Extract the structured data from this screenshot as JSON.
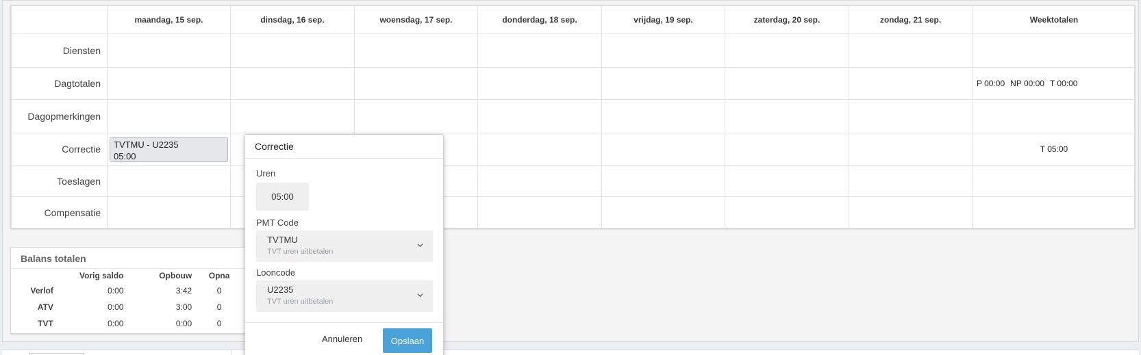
{
  "schedule": {
    "days": [
      "maandag, 15 sep.",
      "dinsdag, 16 sep.",
      "woensdag, 17 sep.",
      "donderdag, 18 sep.",
      "vrijdag, 19 sep.",
      "zaterdag, 20 sep.",
      "zondag, 21 sep."
    ],
    "week_header": "Weektotalen",
    "rows": {
      "diensten": "Diensten",
      "dagtotalen": "Dagtotalen",
      "dagopmerkingen": "Dagopmerkingen",
      "correctie": "Correctie",
      "toeslagen": "Toeslagen",
      "compensatie": "Compensatie"
    },
    "dagtotalen_week": {
      "p": "P 00:00",
      "np": "NP 00:00",
      "t": "T 00:00"
    },
    "correctie_week": "T 05:00",
    "correction_card": {
      "line1": "TVTMU - U2235",
      "line2": "05:00"
    }
  },
  "balans": {
    "title": "Balans totalen",
    "columns": [
      "Vorig saldo",
      "Opbouw",
      "Opna"
    ],
    "rows": [
      {
        "label": "Verlof",
        "vorig": "0:00",
        "opbouw": "3:42",
        "opname": "0"
      },
      {
        "label": "ATV",
        "vorig": "0:00",
        "opbouw": "3:00",
        "opname": "0"
      },
      {
        "label": "TVT",
        "vorig": "0:00",
        "opbouw": "0:00",
        "opname": "0"
      }
    ]
  },
  "popup": {
    "title": "Correctie",
    "uren_label": "Uren",
    "uren_value": "05:00",
    "pmt_label": "PMT Code",
    "pmt_value": "TVTMU",
    "pmt_sub": "TVT uren uitbetalen",
    "loon_label": "Looncode",
    "loon_value": "U2235",
    "loon_sub": "TVT uren uitbetalen",
    "cancel": "Annuleren",
    "save": "Opslaan"
  }
}
